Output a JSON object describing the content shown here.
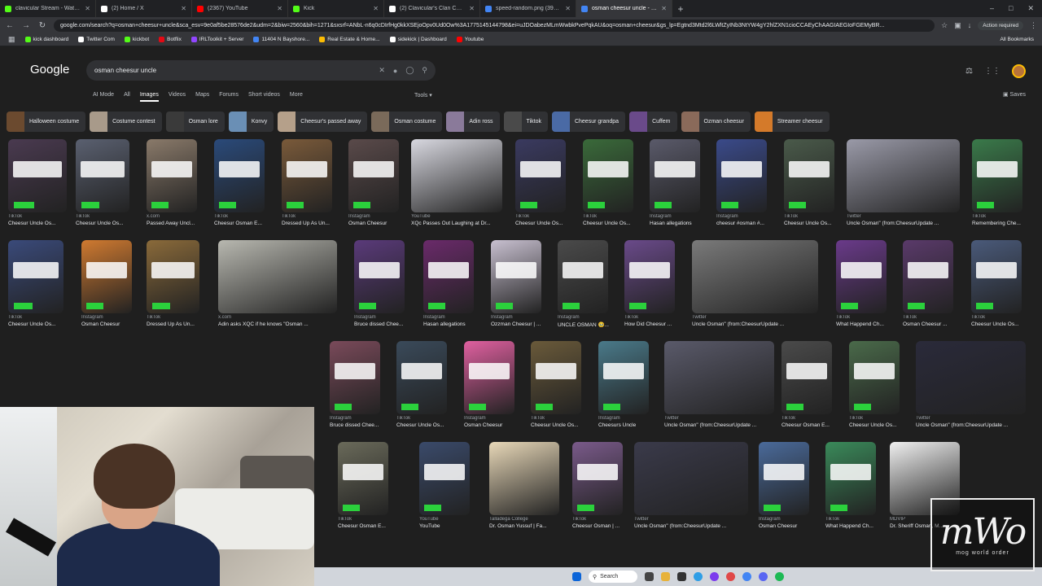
{
  "browser": {
    "tabs": [
      {
        "title": "clavicular Stream - Watch Live",
        "color": "#53fc18"
      },
      {
        "title": "(2) Home / X",
        "color": "#ffffff"
      },
      {
        "title": "(2367) YouTube",
        "color": "#ff0000"
      },
      {
        "title": "Kick",
        "color": "#53fc18"
      },
      {
        "title": "(2) Clavicular's Clan Community",
        "color": "#ffffff"
      },
      {
        "title": "speed-random.png (390×382)",
        "color": "#4285f4"
      },
      {
        "title": "osman cheesur uncle - Google",
        "color": "#4285f4",
        "active": true
      }
    ],
    "url": "google.com/search?q=osman+cheesur+uncle&sca_esv=9e0af5be28576de2&udm=2&biw=2560&bih=1271&sxsrf=ANbL-n6q0cDIrfHg0kkXSEjoOpv0Ud0Ow%3A1775145144798&ei=uJDOabezMLmWwbkPvePqkAU&oq=osman+cheesur&gs_lp=Egtnd3Mtd2l6LWltZyINb3NtYW4gY2hlZXN1cioCCAEyChAAGIAEGIoFGEMyBR...",
    "action_required": "Action required",
    "bookmarks": [
      {
        "label": "kick dashboard",
        "color": "#53fc18"
      },
      {
        "label": "Twitter Com",
        "color": "#ffffff"
      },
      {
        "label": "kickbot",
        "color": "#53fc18"
      },
      {
        "label": "Botflix",
        "color": "#e50914"
      },
      {
        "label": "IRLToolkit + Server",
        "color": "#9146ff"
      },
      {
        "label": "11404 N Bayshore...",
        "color": "#4285f4"
      },
      {
        "label": "Real Estate & Home...",
        "color": "#fbbc04"
      },
      {
        "label": "sidekick | Dashboard",
        "color": "#ffffff"
      },
      {
        "label": "Youtube",
        "color": "#ff0000"
      }
    ],
    "all_bookmarks": "All Bookmarks"
  },
  "google": {
    "logo": "Google",
    "query": "osman cheesur uncle",
    "tabs": [
      "AI Mode",
      "All",
      "Images",
      "Videos",
      "Maps",
      "Forums",
      "Short videos",
      "More"
    ],
    "active_tab": "Images",
    "tools": "Tools",
    "saves": "Saves",
    "chips": [
      {
        "label": "Halloween costume",
        "color": "#6b4a2f"
      },
      {
        "label": "Costume contest",
        "color": "#a89a8a"
      },
      {
        "label": "Osman lore",
        "color": "#3a3a3a"
      },
      {
        "label": "Konvy",
        "color": "#6a8fb5"
      },
      {
        "label": "Cheesur's passed away",
        "color": "#b5a08a"
      },
      {
        "label": "Osman costume",
        "color": "#7a6a5a"
      },
      {
        "label": "Adin ross",
        "color": "#8a7a9a"
      },
      {
        "label": "Tiktok",
        "color": "#4a4a4a"
      },
      {
        "label": "Cheesur grandpa",
        "color": "#4a6aa5"
      },
      {
        "label": "Cuffem",
        "color": "#6a4a8a"
      },
      {
        "label": "Ozman cheesur",
        "color": "#8a6a5a"
      },
      {
        "label": "Streamer cheesur",
        "color": "#d47a2a"
      }
    ],
    "results": [
      {
        "source": "TikTok",
        "title": "Cheesur Uncle Os...",
        "color": "#4a3a50"
      },
      {
        "source": "TikTok",
        "title": "Cheesur Uncle Os...",
        "color": "#5a6070"
      },
      {
        "source": "x.com",
        "title": "Passed Away Uncl...",
        "color": "#8a7a6a"
      },
      {
        "source": "TikTok",
        "title": "Cheesur Osman E...",
        "color": "#2a4a7a"
      },
      {
        "source": "TikTok",
        "title": "Dressed Up As Un...",
        "color": "#7a5a3a"
      },
      {
        "source": "Instagram",
        "title": "Osman Cheesur",
        "color": "#5a4a4a"
      },
      {
        "source": "YouTube",
        "title": "XQc Passes Out Laughing at Dr...",
        "color": "#d8d8e0"
      },
      {
        "source": "TikTok",
        "title": "Cheesur Uncle Os...",
        "color": "#3a3a60"
      },
      {
        "source": "TikTok",
        "title": "Cheesur Uncle Os...",
        "color": "#3a6a3a"
      },
      {
        "source": "Instagram",
        "title": "Hasan allegations",
        "color": "#5a5a6a"
      },
      {
        "source": "Instagram",
        "title": "cheesur #osman #...",
        "color": "#3a4a8a"
      },
      {
        "source": "TikTok",
        "title": "Cheesur Uncle Os...",
        "color": "#4a5a4a"
      },
      {
        "source": "Twitter",
        "title": "Uncle Osman\" (from:CheesurUpdate ...",
        "color": "#9a9aa8"
      },
      {
        "source": "TikTok",
        "title": "Remembering Che...",
        "color": "#3a7a4a"
      },
      {
        "source": "TikTok",
        "title": "Cheesur Uncle Os...",
        "color": "#3a4a7a"
      },
      {
        "source": "Instagram",
        "title": "Osman Cheesur",
        "color": "#d07a30"
      },
      {
        "source": "TikTok",
        "title": "Dressed Up As Un...",
        "color": "#8a6a3a"
      },
      {
        "source": "x.com",
        "title": "Adin asks XQC if he knows \"Osman ...",
        "color": "#b8b8b0"
      },
      {
        "source": "Instagram",
        "title": "Bruce dissed Chee...",
        "color": "#5a3a7a"
      },
      {
        "source": "Instagram",
        "title": "Hasan allegations",
        "color": "#6a2a6a"
      },
      {
        "source": "Instagram",
        "title": "Ozzman Cheesur | ...",
        "color": "#c8c0d0"
      },
      {
        "source": "Instagram",
        "title": "UNCLE OSMAN 🥹...",
        "color": "#4a4a4a"
      },
      {
        "source": "TikTok",
        "title": "How Did Cheesur ...",
        "color": "#6a4a8a"
      },
      {
        "source": "Twitter",
        "title": "Uncle Osman\" (from:CheesurUpdate ...",
        "color": "#7a7a7a"
      },
      {
        "source": "TikTok",
        "title": "What Happend Ch...",
        "color": "#6a3a8a"
      },
      {
        "source": "TikTok",
        "title": "Osman Cheesur ...",
        "color": "#5a3a6a"
      },
      {
        "source": "TikTok",
        "title": "Cheesur Uncle Os...",
        "color": "#4a5a7a"
      },
      {
        "source": "Instagram",
        "title": "Bruce dissed Chee...",
        "color": "#7a4a5a"
      },
      {
        "source": "TikTok",
        "title": "Cheesur Uncle Os...",
        "color": "#3a4a5a"
      },
      {
        "source": "Instagram",
        "title": "Osman Cheesur",
        "color": "#e060a0"
      },
      {
        "source": "TikTok",
        "title": "Cheesur Uncle Os...",
        "color": "#6a5a3a"
      },
      {
        "source": "Instagram",
        "title": "Cheesurs Uncle",
        "color": "#4a7a8a"
      },
      {
        "source": "Twitter",
        "title": "Uncle Osman\" (from:CheesurUpdate ...",
        "color": "#5a5a6a"
      },
      {
        "source": "TikTok",
        "title": "Cheesur Osman E...",
        "color": "#4a4a4a"
      },
      {
        "source": "TikTok",
        "title": "Cheesur Uncle Os...",
        "color": "#4a6a4a"
      },
      {
        "source": "Twitter",
        "title": "Uncle Osman\" (from:CheesurUpdate ...",
        "color": "#2a2a3a"
      },
      {
        "source": "TikTok",
        "title": "Cheesur Osman E...",
        "color": "#6a6a5a"
      },
      {
        "source": "YouTube",
        "title": "YouTube",
        "color": "#3a4a6a"
      },
      {
        "source": "Talladega College",
        "title": "Dr. Osman Yussuf | Fa...",
        "color": "#e8d8b8"
      },
      {
        "source": "TikTok",
        "title": "Cheesur Osman | ...",
        "color": "#7a5a8a"
      },
      {
        "source": "Twitter",
        "title": "Uncle Osman\" (from:CheesurUpdate ...",
        "color": "#3a3a4a"
      },
      {
        "source": "Instagram",
        "title": "Osman Cheesur",
        "color": "#4a6a9a"
      },
      {
        "source": "TikTok",
        "title": "What Happend Ch...",
        "color": "#3a8a5a"
      },
      {
        "source": "MDVIP",
        "title": "Dr. Sheriff Osman, M...",
        "color": "#f0f0f0"
      }
    ]
  },
  "taskbar": {
    "search_label": "Search"
  },
  "watermark": {
    "logo_text": "mWo",
    "tagline": "mog world order"
  }
}
